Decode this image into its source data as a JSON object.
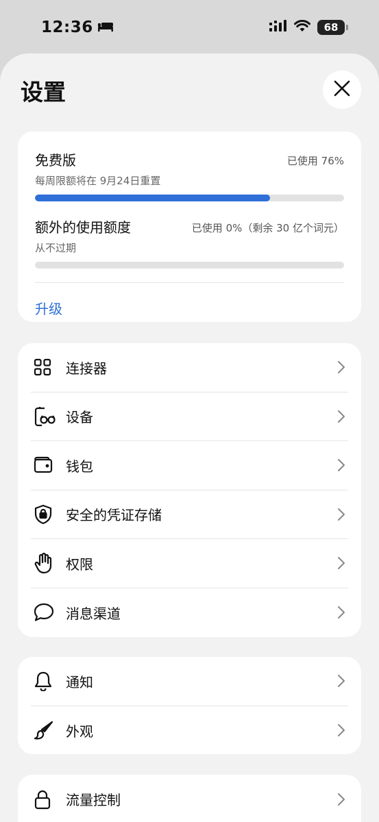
{
  "status_bar": {
    "time": "12:36",
    "battery": "68"
  },
  "header": {
    "title": "设置"
  },
  "usage": {
    "plan_name": "免费版",
    "plan_used_text": "已使用 76%",
    "plan_reset_text": "每周限额将在 9月24日重置",
    "plan_progress_percent": 76,
    "extra_title": "额外的使用额度",
    "extra_used_text": "已使用 0%（剩余 30 亿个词元）",
    "extra_sub": "从不过期",
    "extra_progress_percent": 0,
    "upgrade_label": "升级"
  },
  "group1": {
    "items": [
      {
        "label": "连接器",
        "icon": "grid-icon"
      },
      {
        "label": "设备",
        "icon": "device-icon"
      },
      {
        "label": "钱包",
        "icon": "wallet-icon"
      },
      {
        "label": "安全的凭证存储",
        "icon": "shield-lock-icon"
      },
      {
        "label": "权限",
        "icon": "hand-icon"
      },
      {
        "label": "消息渠道",
        "icon": "chat-bubble-icon"
      }
    ]
  },
  "group2": {
    "items": [
      {
        "label": "通知",
        "icon": "bell-icon"
      },
      {
        "label": "外观",
        "icon": "paintbrush-icon"
      }
    ]
  },
  "group3": {
    "items": [
      {
        "label": "流量控制",
        "icon": "lock-icon"
      }
    ]
  },
  "colors": {
    "accent": "#2f6fd7",
    "sheet_bg": "#f2f2f2",
    "card_bg": "#ffffff"
  }
}
